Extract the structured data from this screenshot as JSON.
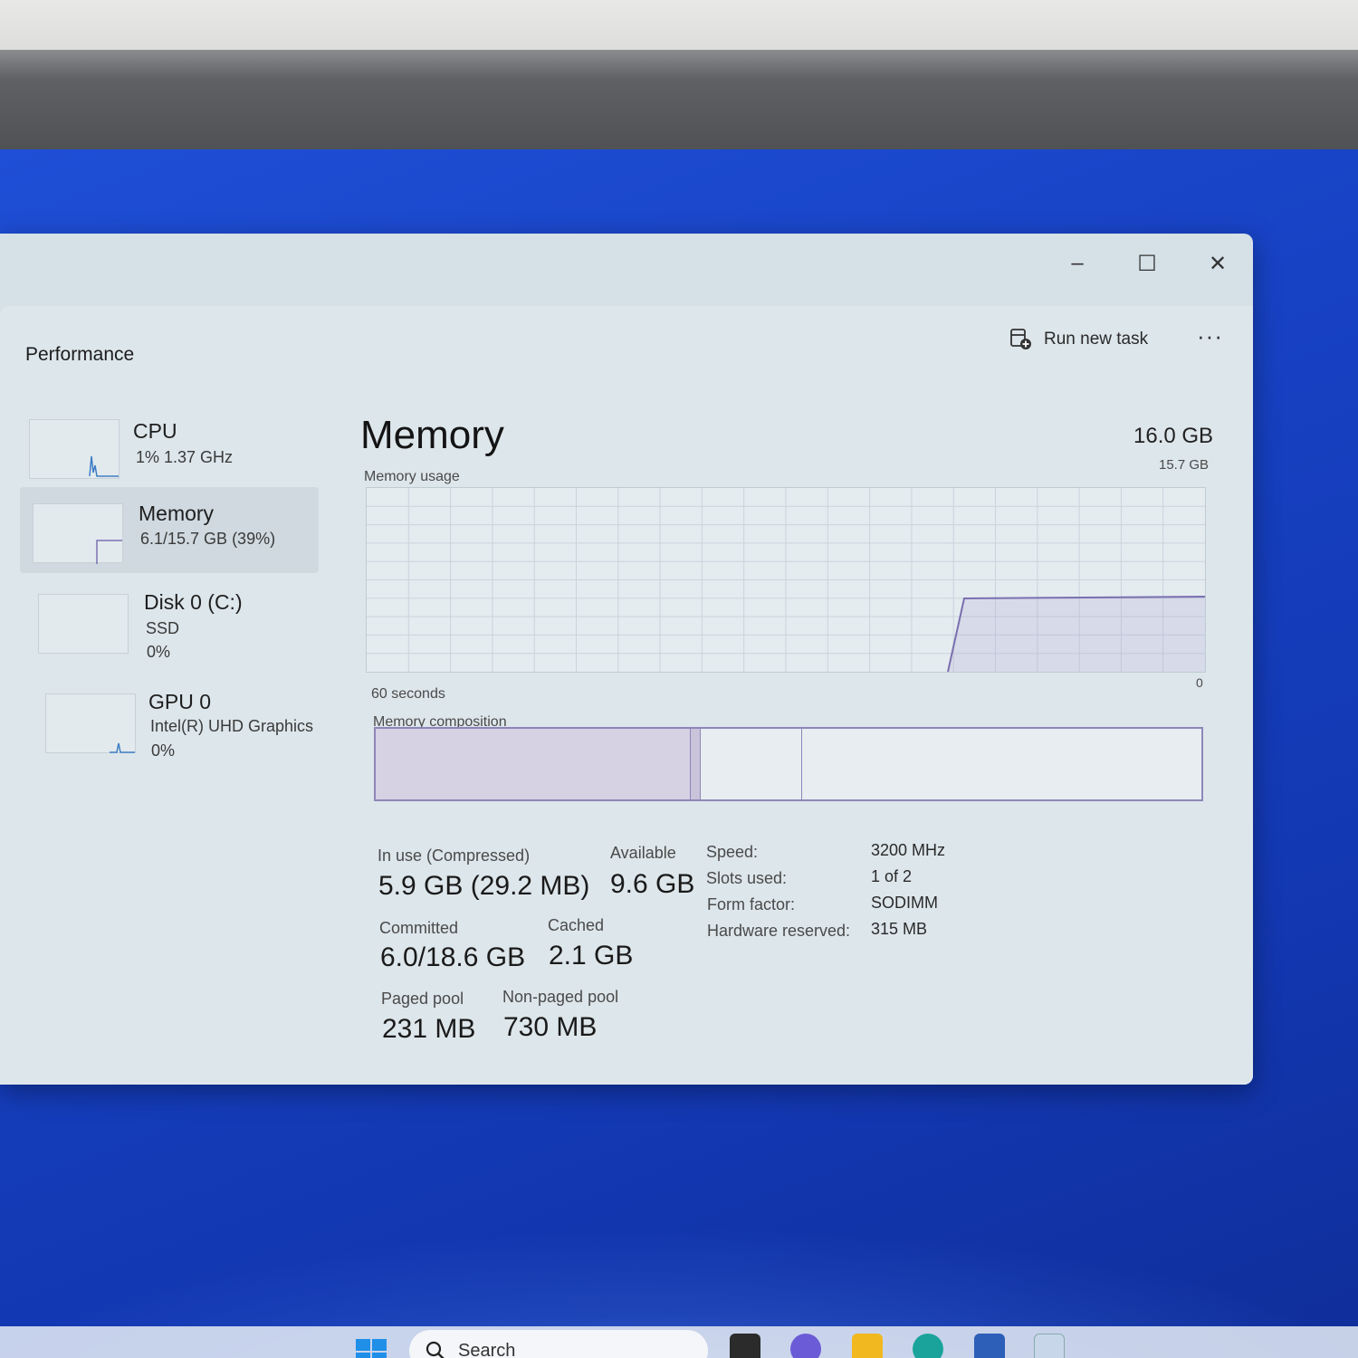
{
  "window": {
    "controls": {
      "minimize": "–",
      "maximize": "☐",
      "close": "✕"
    }
  },
  "header": {
    "title": "Performance",
    "run_new_task": "Run new task",
    "more": "···"
  },
  "sidebar": {
    "items": [
      {
        "name": "CPU",
        "line1": "1% 1.37 GHz",
        "line2": ""
      },
      {
        "name": "Memory",
        "line1": "6.1/15.7 GB (39%)",
        "line2": ""
      },
      {
        "name": "Disk 0 (C:)",
        "line1": "SSD",
        "line2": "0%"
      },
      {
        "name": "GPU 0",
        "line1": "Intel(R) UHD Graphics",
        "line2": "0%"
      }
    ],
    "selected_index": 1
  },
  "main": {
    "title": "Memory",
    "total": "16.0 GB",
    "usage_label": "Memory usage",
    "usage_max": "15.7 GB",
    "graph_time_label": "60 seconds",
    "graph_zero": "0",
    "composition_label": "Memory composition",
    "stats": {
      "in_use_label": "In use (Compressed)",
      "in_use_value": "5.9 GB (29.2 MB)",
      "available_label": "Available",
      "available_value": "9.6 GB",
      "committed_label": "Committed",
      "committed_value": "6.0/18.6 GB",
      "cached_label": "Cached",
      "cached_value": "2.1 GB",
      "paged_label": "Paged pool",
      "paged_value": "231 MB",
      "nonpaged_label": "Non-paged pool",
      "nonpaged_value": "730 MB"
    },
    "specs": [
      {
        "label": "Speed:",
        "value": "3200 MHz"
      },
      {
        "label": "Slots used:",
        "value": "1 of 2"
      },
      {
        "label": "Form factor:",
        "value": "SODIMM"
      },
      {
        "label": "Hardware reserved:",
        "value": "315 MB"
      }
    ]
  },
  "taskbar": {
    "search_placeholder": "Search"
  },
  "colors": {
    "memory_accent": "#8e86b8",
    "memory_fill": "#d6d1e3",
    "desktop_blue": "#1742c4"
  }
}
